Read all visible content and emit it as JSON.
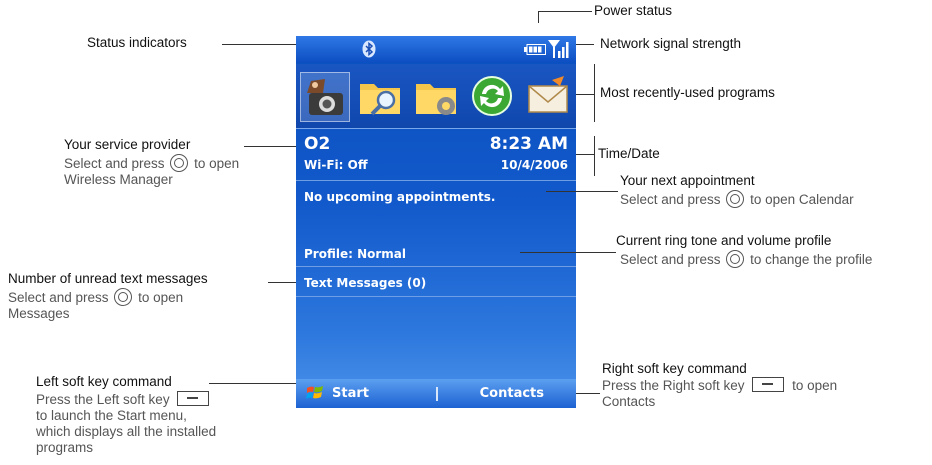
{
  "phone": {
    "provider": "O2",
    "wifi": "Wi-Fi: Off",
    "time": "8:23 AM",
    "date": "10/4/2006",
    "appointment": "No upcoming appointments.",
    "profile": "Profile: Normal",
    "text_messages": "Text Messages (0)",
    "soft_left": "Start",
    "soft_right": "Contacts",
    "status_icons": [
      "bluetooth-icon",
      "battery-icon",
      "signal-icon"
    ],
    "recent_programs": [
      "camera-icon",
      "search-folder-icon",
      "settings-folder-icon",
      "sync-icon",
      "email-icon"
    ]
  },
  "callouts": {
    "power_status": "Power status",
    "status_indicators": "Status indicators",
    "network_signal": "Network signal strength",
    "recent_programs": "Most recently-used programs",
    "service_provider": {
      "title": "Your service provider",
      "line1_pre": "Select and press",
      "line1_post": "to open",
      "line2": "Wireless Manager"
    },
    "time_date": "Time/Date",
    "next_appointment": {
      "title": "Your next appointment",
      "line1_pre": "Select and press",
      "line1_post": "to open Calendar"
    },
    "ring_profile": {
      "title": "Current ring tone and volume profile",
      "line1_pre": "Select and press",
      "line1_post": "to change the profile"
    },
    "unread_messages": {
      "title": "Number of unread text messages",
      "line1_pre": "Select and press",
      "line1_post": "to open",
      "line2": "Messages"
    },
    "left_soft_key": {
      "title": "Left soft key command",
      "line1": "Press the Left soft key",
      "line2": "to launch the Start menu,",
      "line3": "which displays all the installed",
      "line4": "programs"
    },
    "right_soft_key": {
      "title": "Right soft key command",
      "line1_pre": "Press the Right soft key",
      "line1_post": "to open",
      "line2": "Contacts"
    }
  }
}
